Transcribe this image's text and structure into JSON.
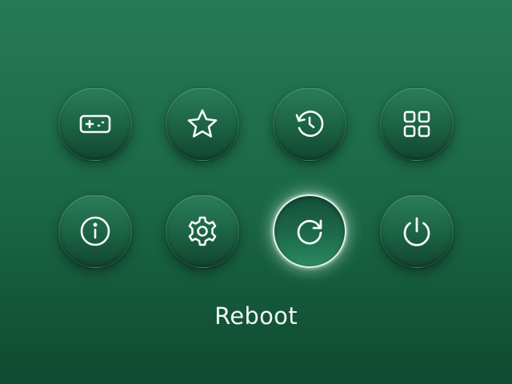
{
  "menu": {
    "items": [
      {
        "name": "games",
        "icon": "gamepad-icon"
      },
      {
        "name": "favorites",
        "icon": "star-icon"
      },
      {
        "name": "history",
        "icon": "history-icon"
      },
      {
        "name": "apps",
        "icon": "grid-icon"
      },
      {
        "name": "info",
        "icon": "info-icon"
      },
      {
        "name": "settings",
        "icon": "gear-icon"
      },
      {
        "name": "reboot",
        "icon": "refresh-icon",
        "selected": true
      },
      {
        "name": "power",
        "icon": "power-icon"
      }
    ],
    "selected_label": "Reboot"
  },
  "colors": {
    "background_top": "#267a58",
    "background_bottom": "#0f4a31",
    "icon_stroke": "#f4faf6",
    "selected_ring": "#e6f2ea"
  }
}
